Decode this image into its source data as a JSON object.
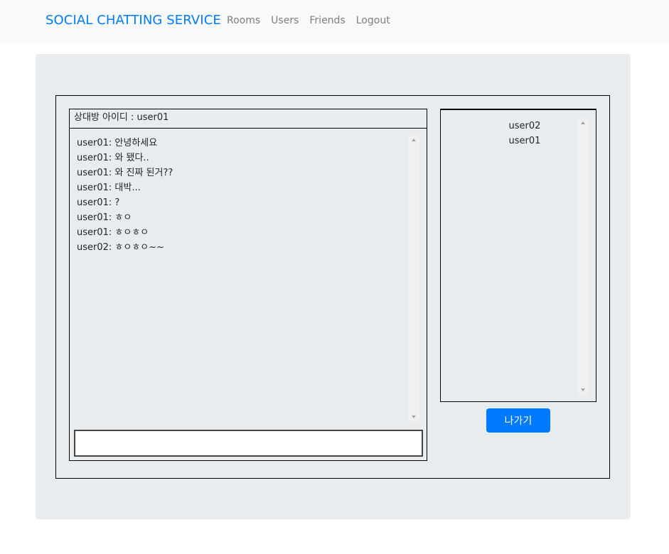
{
  "navbar": {
    "brand": "SOCIAL CHATTING SERVICE",
    "links": [
      "Rooms",
      "Users",
      "Friends",
      "Logout"
    ]
  },
  "chat": {
    "header": "상대방 아이디 : user01",
    "messages": [
      "user01: 안녕하세요",
      "user01: 와 됐다..",
      "user01: 와 진짜 된거??",
      "user01: 대박...",
      "user01: ?",
      "user01: ㅎㅇ",
      "user01: ㅎㅇㅎㅇ",
      "user02: ㅎㅇㅎㅇ~~"
    ],
    "input_value": ""
  },
  "users": {
    "items": [
      "user02",
      "user01"
    ]
  },
  "leave_button": "나가기",
  "colors": {
    "brand": "#007bff",
    "button": "#007bff",
    "navbar_bg": "#f8f9fa",
    "jumbotron_bg": "#e9ecef"
  }
}
